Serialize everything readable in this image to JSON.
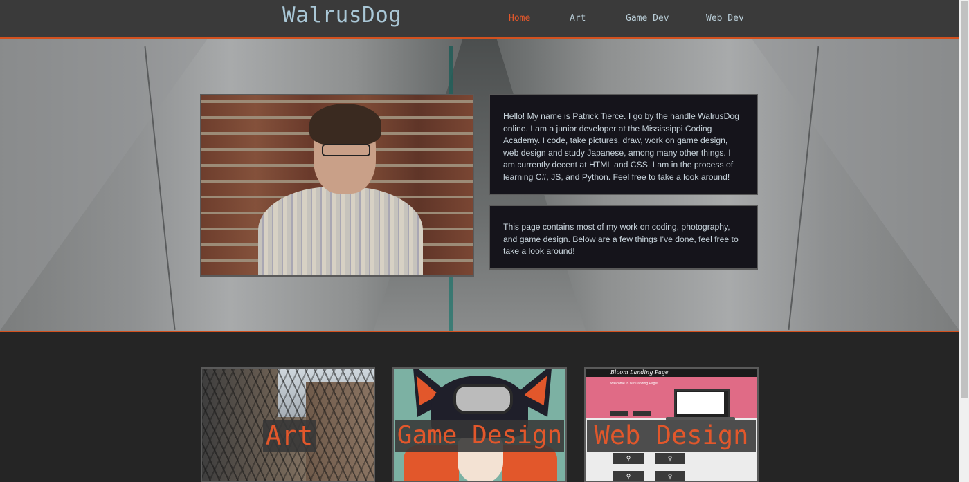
{
  "header": {
    "logo": "WalrusDog",
    "nav": [
      {
        "label": "Home",
        "active": true
      },
      {
        "label": "Art",
        "active": false
      },
      {
        "label": "Game Dev",
        "active": false
      },
      {
        "label": "Web Dev",
        "active": false
      }
    ]
  },
  "hero": {
    "intro": "Hello! My name is Patrick Tierce. I go by the handle WalrusDog online. I am a junior developer at the Mississippi Coding Academy. I code, take pictures, draw, work on game design, web design and study Japanese, among many other things. I am currently decent at HTML and CSS. I am in the process of learning C#, JS, and Python. Feel free to take a look around!",
    "about": "This page contains most of my work on coding, photography, and game design. Below are a few things I've done, feel free to take a look around!"
  },
  "cards": [
    {
      "label": "Art"
    },
    {
      "label": "Game Design"
    },
    {
      "label": "Web Design",
      "preview_title": "Bloom Landing Page",
      "preview_heading": "Welcome to our Landing Page!"
    }
  ],
  "colors": {
    "accent": "#e2572b",
    "header_bg": "#3a3a3a",
    "page_bg": "#252525",
    "box_bg": "#15141b"
  }
}
